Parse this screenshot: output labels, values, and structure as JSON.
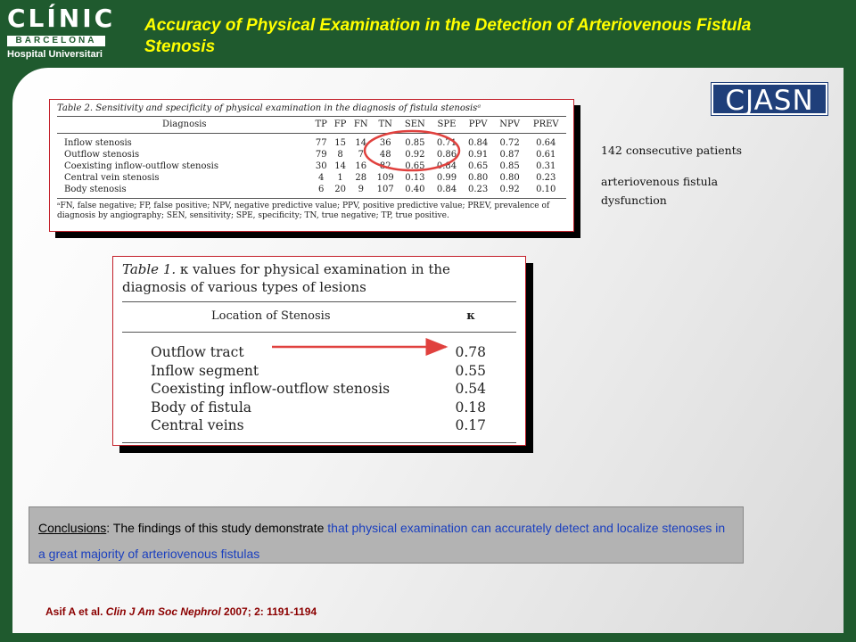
{
  "logo": {
    "main": "CLÍNIC",
    "sub": "BARCELONA",
    "hospital": "Hospital Universitari"
  },
  "slide_title": "Accuracy of Physical Examination in the Detection of Arteriovenous Fistula Stenosis",
  "badge": "CJASN",
  "table2": {
    "caption": "Table 2. Sensitivity and specificity of physical examination in the diagnosis of fistula stenosisᵃ",
    "columns": [
      "Diagnosis",
      "TP",
      "FP",
      "FN",
      "TN",
      "SEN",
      "SPE",
      "PPV",
      "NPV",
      "PREV"
    ],
    "rows": [
      [
        "Inflow stenosis",
        "77",
        "15",
        "14",
        "36",
        "0.85",
        "0.71",
        "0.84",
        "0.72",
        "0.64"
      ],
      [
        "Outflow stenosis",
        "79",
        "8",
        "7",
        "48",
        "0.92",
        "0.86",
        "0.91",
        "0.87",
        "0.61"
      ],
      [
        "Coexisting inflow-outflow stenosis",
        "30",
        "14",
        "16",
        "82",
        "0.65",
        "0.84",
        "0.65",
        "0.85",
        "0.31"
      ],
      [
        "Central vein stenosis",
        "4",
        "1",
        "28",
        "109",
        "0.13",
        "0.99",
        "0.80",
        "0.80",
        "0.23"
      ],
      [
        "Body stenosis",
        "6",
        "20",
        "9",
        "107",
        "0.40",
        "0.84",
        "0.23",
        "0.92",
        "0.10"
      ]
    ],
    "footnote": "ᵃFN, false negative; FP, false positive; NPV, negative predictive value; PPV, positive predictive value; PREV, prevalence of diagnosis by angiography; SEN, sensitivity; SPE, specificity; TN, true negative; TP, true positive."
  },
  "table1": {
    "caption_prefix": "Table 1.",
    "caption_rest": " κ values for physical examination in the diagnosis of various types of lesions",
    "col_location": "Location of Stenosis",
    "col_kappa": "κ",
    "rows": [
      {
        "location": "Outflow tract",
        "kappa": "0.78"
      },
      {
        "location": "Inflow segment",
        "kappa": "0.55"
      },
      {
        "location": "Coexisting inflow-outflow stenosis",
        "kappa": "0.54"
      },
      {
        "location": "Body of fistula",
        "kappa": "0.18"
      },
      {
        "location": "Central veins",
        "kappa": "0.17"
      }
    ]
  },
  "side_notes": [
    "142 consecutive patients",
    "arteriovenous fistula dysfunction"
  ],
  "conclusion": {
    "label": "Conclusions",
    "plain": ": The findings of this study demonstrate ",
    "highlight": "that physical examination can accurately detect and localize stenoses in a great majority of arteriovenous fistulas"
  },
  "citation": {
    "authors": "Asif A et al. ",
    "journal": "Clin J Am Soc Nephrol",
    "rest": " 2007; 2: 1191-1194"
  },
  "colors": {
    "background": "#1f5a2e",
    "title": "#ffff00",
    "highlight_blue": "#1a3fbf",
    "annotation_red": "#e0413e",
    "citation": "#8b0000"
  }
}
